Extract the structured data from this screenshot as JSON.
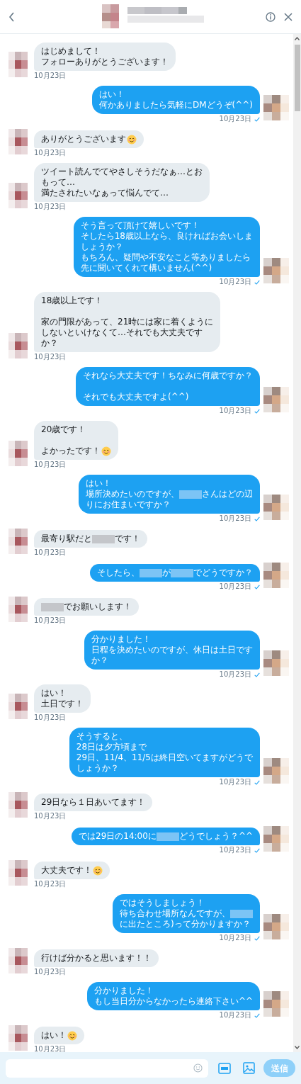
{
  "composer": {
    "send_label": "送信",
    "send_disabled": true
  },
  "messages": [
    {
      "kind": "received",
      "time": "10月23日",
      "lines": [
        {
          "kind": "text",
          "segments": [
            {
              "kind": "text",
              "text": "はじめまして！"
            }
          ]
        },
        {
          "kind": "text",
          "segments": [
            {
              "kind": "text",
              "text": "フォローありがとうございます！"
            }
          ]
        }
      ]
    },
    {
      "kind": "sent",
      "time": "10月23日",
      "read": true,
      "lines": [
        {
          "kind": "text",
          "segments": [
            {
              "kind": "text",
              "text": "はい！"
            }
          ]
        },
        {
          "kind": "text",
          "segments": [
            {
              "kind": "text",
              "text": "何かありましたら気軽にDMどうぞ(^^)"
            }
          ]
        }
      ]
    },
    {
      "kind": "received",
      "time": "10月23日",
      "lines": [
        {
          "kind": "text",
          "segments": [
            {
              "kind": "text",
              "text": "ありがとうございます"
            },
            {
              "kind": "emoji"
            }
          ]
        }
      ]
    },
    {
      "kind": "received",
      "time": "10月23日",
      "lines": [
        {
          "kind": "text",
          "segments": [
            {
              "kind": "text",
              "text": "ツイート読んでてやさしそうだなぁ…とお"
            }
          ]
        },
        {
          "kind": "text",
          "segments": [
            {
              "kind": "text",
              "text": "もって…"
            }
          ]
        },
        {
          "kind": "text",
          "segments": [
            {
              "kind": "text",
              "text": "満たされたいなぁって悩んでて…"
            }
          ]
        }
      ]
    },
    {
      "kind": "sent",
      "time": "10月23日",
      "read": true,
      "lines": [
        {
          "kind": "text",
          "segments": [
            {
              "kind": "text",
              "text": "そう言って頂けて嬉しいです！"
            }
          ]
        },
        {
          "kind": "text",
          "segments": [
            {
              "kind": "text",
              "text": "そしたら18歳以上なら、良ければお会いしま"
            }
          ]
        },
        {
          "kind": "text",
          "segments": [
            {
              "kind": "text",
              "text": "しょうか？"
            }
          ]
        },
        {
          "kind": "text",
          "segments": [
            {
              "kind": "text",
              "text": "もちろん、疑問や不安なこと等ありましたら"
            }
          ]
        },
        {
          "kind": "text",
          "segments": [
            {
              "kind": "text",
              "text": "先に聞いてくれて構いません(^^)"
            }
          ]
        }
      ]
    },
    {
      "kind": "received",
      "time": "10月23日",
      "lines": [
        {
          "kind": "text",
          "segments": [
            {
              "kind": "text",
              "text": "18歳以上です！"
            }
          ]
        },
        {
          "kind": "blank"
        },
        {
          "kind": "text",
          "segments": [
            {
              "kind": "text",
              "text": "家の門限があって、21時には家に着くように"
            }
          ]
        },
        {
          "kind": "text",
          "segments": [
            {
              "kind": "text",
              "text": "しないといけなくて…それでも大丈夫です"
            }
          ]
        },
        {
          "kind": "text",
          "segments": [
            {
              "kind": "text",
              "text": "か？"
            }
          ]
        }
      ]
    },
    {
      "kind": "sent",
      "time": "10月23日",
      "read": true,
      "lines": [
        {
          "kind": "text",
          "segments": [
            {
              "kind": "text",
              "text": "それなら大丈夫です！ちなみに何歳ですか？"
            }
          ]
        },
        {
          "kind": "blank"
        },
        {
          "kind": "text",
          "segments": [
            {
              "kind": "text",
              "text": "それでも大丈夫ですよ(^^)"
            }
          ]
        }
      ]
    },
    {
      "kind": "received",
      "time": "10月23日",
      "lines": [
        {
          "kind": "text",
          "segments": [
            {
              "kind": "text",
              "text": "20歳です！"
            }
          ]
        },
        {
          "kind": "blank"
        },
        {
          "kind": "text",
          "segments": [
            {
              "kind": "text",
              "text": "よかったです！"
            },
            {
              "kind": "emoji"
            }
          ]
        }
      ]
    },
    {
      "kind": "sent",
      "time": "10月23日",
      "read": true,
      "lines": [
        {
          "kind": "text",
          "segments": [
            {
              "kind": "text",
              "text": "はい！"
            }
          ]
        },
        {
          "kind": "text",
          "segments": [
            {
              "kind": "text",
              "text": "場所決めたいのですが、"
            },
            {
              "kind": "redacted"
            },
            {
              "kind": "text",
              "text": "さんはどの辺"
            }
          ]
        },
        {
          "kind": "text",
          "segments": [
            {
              "kind": "text",
              "text": "りにお住まいですか？"
            }
          ]
        }
      ]
    },
    {
      "kind": "received",
      "time": "10月23日",
      "lines": [
        {
          "kind": "text",
          "segments": [
            {
              "kind": "text",
              "text": "最寄り駅だと"
            },
            {
              "kind": "redacted"
            },
            {
              "kind": "text",
              "text": "です！"
            }
          ]
        }
      ]
    },
    {
      "kind": "sent",
      "time": "10月23日",
      "read": true,
      "lines": [
        {
          "kind": "text",
          "segments": [
            {
              "kind": "text",
              "text": "そしたら、"
            },
            {
              "kind": "redacted"
            },
            {
              "kind": "text",
              "text": "が"
            },
            {
              "kind": "redacted"
            },
            {
              "kind": "text",
              "text": "でどうですか？"
            }
          ]
        }
      ]
    },
    {
      "kind": "received",
      "time": "10月23日",
      "lines": [
        {
          "kind": "text",
          "segments": [
            {
              "kind": "redacted"
            },
            {
              "kind": "text",
              "text": "でお願いします！"
            }
          ]
        }
      ]
    },
    {
      "kind": "sent",
      "time": "10月23日",
      "read": true,
      "lines": [
        {
          "kind": "text",
          "segments": [
            {
              "kind": "text",
              "text": "分かりました！"
            }
          ]
        },
        {
          "kind": "text",
          "segments": [
            {
              "kind": "text",
              "text": "日程を決めたいのですが、休日は土日です"
            }
          ]
        },
        {
          "kind": "text",
          "segments": [
            {
              "kind": "text",
              "text": "か？"
            }
          ]
        }
      ]
    },
    {
      "kind": "received",
      "time": "10月23日",
      "lines": [
        {
          "kind": "text",
          "segments": [
            {
              "kind": "text",
              "text": "はい！"
            }
          ]
        },
        {
          "kind": "text",
          "segments": [
            {
              "kind": "text",
              "text": "土日です！"
            }
          ]
        }
      ]
    },
    {
      "kind": "sent",
      "time": "10月23日",
      "read": true,
      "lines": [
        {
          "kind": "text",
          "segments": [
            {
              "kind": "text",
              "text": "そうすると、"
            }
          ]
        },
        {
          "kind": "text",
          "segments": [
            {
              "kind": "text",
              "text": "28日は夕方頃まで"
            }
          ]
        },
        {
          "kind": "text",
          "segments": [
            {
              "kind": "text",
              "text": "29日、11/4、11/5は終日空いてますがどうで"
            }
          ]
        },
        {
          "kind": "text",
          "segments": [
            {
              "kind": "text",
              "text": "しょうか？"
            }
          ]
        }
      ]
    },
    {
      "kind": "received",
      "time": "10月23日",
      "lines": [
        {
          "kind": "text",
          "segments": [
            {
              "kind": "text",
              "text": "29日なら１日あいてます！"
            }
          ]
        }
      ]
    },
    {
      "kind": "sent",
      "time": "10月23日",
      "read": true,
      "lines": [
        {
          "kind": "text",
          "segments": [
            {
              "kind": "text",
              "text": "では29日の14:00に"
            },
            {
              "kind": "redacted"
            },
            {
              "kind": "text",
              "text": "どうでしょう？^^"
            }
          ]
        }
      ]
    },
    {
      "kind": "received",
      "time": "10月23日",
      "lines": [
        {
          "kind": "text",
          "segments": [
            {
              "kind": "text",
              "text": "大丈夫です！"
            },
            {
              "kind": "emoji"
            }
          ]
        }
      ]
    },
    {
      "kind": "sent",
      "time": "10月23日",
      "read": true,
      "lines": [
        {
          "kind": "text",
          "segments": [
            {
              "kind": "text",
              "text": "ではそうしましょう！"
            }
          ]
        },
        {
          "kind": "text",
          "segments": [
            {
              "kind": "text",
              "text": "待ち合わせ場所なんですが、"
            },
            {
              "kind": "redacted"
            }
          ]
        },
        {
          "kind": "text",
          "segments": [
            {
              "kind": "text",
              "text": "に出たところ)って分かりますか？"
            }
          ]
        }
      ]
    },
    {
      "kind": "received",
      "time": "10月23日",
      "lines": [
        {
          "kind": "text",
          "segments": [
            {
              "kind": "text",
              "text": "行けば分かると思います！！"
            }
          ]
        }
      ]
    },
    {
      "kind": "sent",
      "time": "10月23日",
      "read": true,
      "lines": [
        {
          "kind": "text",
          "segments": [
            {
              "kind": "text",
              "text": "分かりました！"
            }
          ]
        },
        {
          "kind": "text",
          "segments": [
            {
              "kind": "text",
              "text": "もし当日分からなかったら連絡下さい^^"
            }
          ]
        }
      ]
    },
    {
      "kind": "received",
      "time": "10月23日",
      "lines": [
        {
          "kind": "text",
          "segments": [
            {
              "kind": "text",
              "text": "はい！"
            },
            {
              "kind": "emoji"
            }
          ]
        }
      ]
    }
  ]
}
